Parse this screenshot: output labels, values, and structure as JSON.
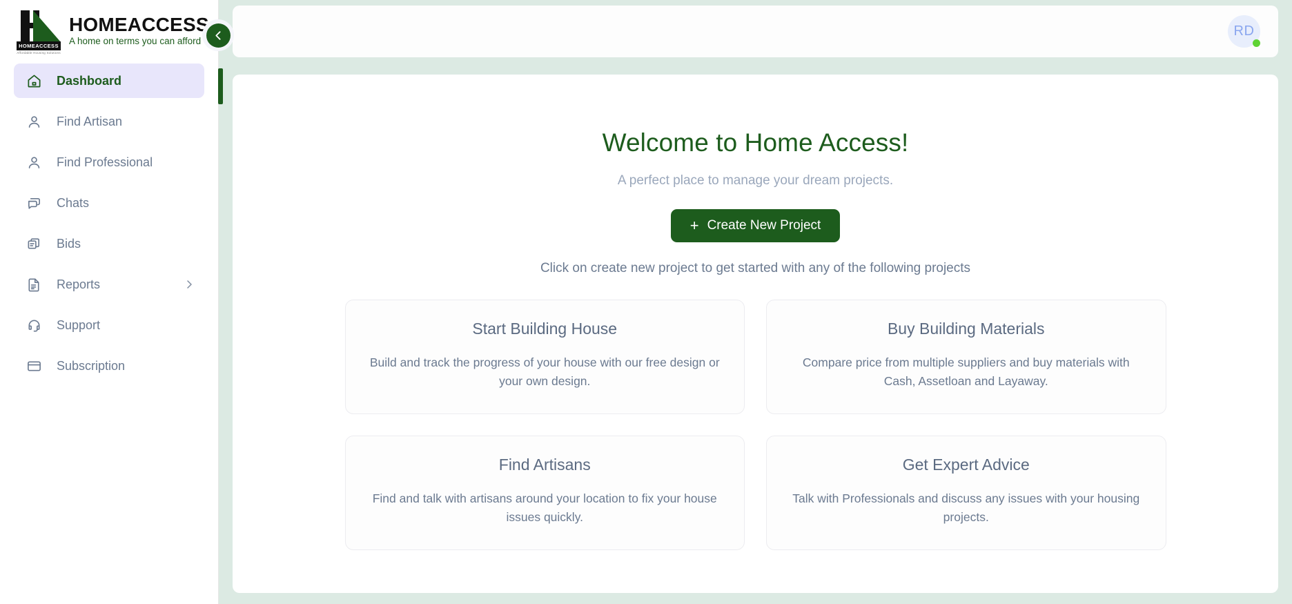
{
  "brand": {
    "title": "HOMEACCESS",
    "tagline": "A home on terms you can afford",
    "logo_plate": "HOMEACCESS",
    "logo_plate_sub": "Affordable Housing Solutions",
    "accent_green": "#1d5c1d"
  },
  "sidebar": {
    "collapse_icon": "chevron-left-icon",
    "items": [
      {
        "label": "Dashboard",
        "icon": "home-icon",
        "active": true
      },
      {
        "label": "Find Artisan",
        "icon": "user-icon",
        "active": false
      },
      {
        "label": "Find Professional",
        "icon": "user-icon",
        "active": false
      },
      {
        "label": "Chats",
        "icon": "chat-bubble-icon",
        "active": false
      },
      {
        "label": "Bids",
        "icon": "copy-icon",
        "active": false
      },
      {
        "label": "Reports",
        "icon": "document-icon",
        "active": false,
        "chevron": "chevron-right-icon"
      },
      {
        "label": "Support",
        "icon": "headset-icon",
        "active": false
      },
      {
        "label": "Subscription",
        "icon": "credit-card-icon",
        "active": false
      }
    ]
  },
  "topbar": {
    "avatar_initials": "RD",
    "status_color": "#5fd334"
  },
  "main": {
    "welcome_title": "Welcome to Home Access!",
    "welcome_subtitle": "A perfect place to manage your dream projects.",
    "create_button": "Create New Project",
    "create_button_plus": "+",
    "hint": "Click on create new project to get started with any of the following projects",
    "cards": [
      {
        "title": "Start Building House",
        "desc": "Build and track the progress of your house with our free design or your own design."
      },
      {
        "title": "Buy Building Materials",
        "desc": "Compare price from multiple suppliers and buy materials with Cash, Assetloan and Layaway."
      },
      {
        "title": "Find Artisans",
        "desc": "Find and talk with artisans around your location to fix your house issues quickly."
      },
      {
        "title": "Get Expert Advice",
        "desc": "Talk with Professionals and discuss any issues with your housing projects."
      }
    ]
  }
}
